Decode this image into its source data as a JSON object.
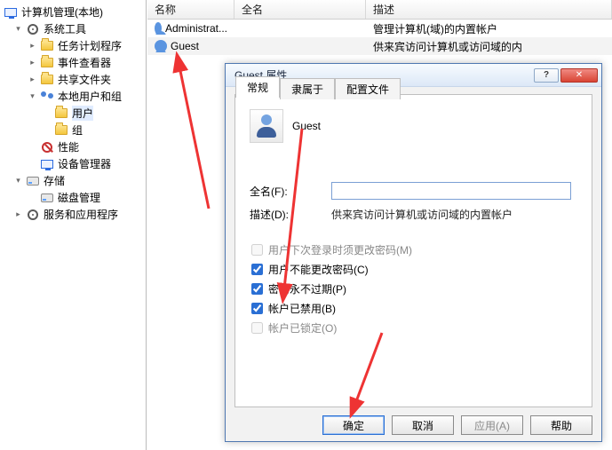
{
  "tree": {
    "root": "计算机管理(本地)",
    "items": [
      {
        "toggle": "▾",
        "icon": "gear",
        "label": "系统工具"
      },
      {
        "toggle": "▸",
        "icon": "folder",
        "label": "任务计划程序",
        "depth": 3
      },
      {
        "toggle": "▸",
        "icon": "folder",
        "label": "事件查看器",
        "depth": 3
      },
      {
        "toggle": "▸",
        "icon": "folder",
        "label": "共享文件夹",
        "depth": 3
      },
      {
        "toggle": "▾",
        "icon": "users",
        "label": "本地用户和组",
        "depth": 3
      },
      {
        "toggle": "",
        "icon": "folder",
        "label": "用户",
        "depth": 4,
        "selected": true
      },
      {
        "toggle": "",
        "icon": "folder",
        "label": "组",
        "depth": 4
      },
      {
        "toggle": "",
        "icon": "noentry",
        "label": "性能",
        "depth": 3
      },
      {
        "toggle": "",
        "icon": "monitor",
        "label": "设备管理器",
        "depth": 3
      },
      {
        "toggle": "▾",
        "icon": "disk",
        "label": "存储",
        "depth": 2
      },
      {
        "toggle": "",
        "icon": "disk",
        "label": "磁盘管理",
        "depth": 3
      },
      {
        "toggle": "▸",
        "icon": "gear",
        "label": "服务和应用程序",
        "depth": 2
      }
    ]
  },
  "list": {
    "headers": {
      "name": "名称",
      "full": "全名",
      "desc": "描述"
    },
    "rows": [
      {
        "name": "Administrat...",
        "full": "",
        "desc": "管理计算机(域)的内置帐户"
      },
      {
        "name": "Guest",
        "full": "",
        "desc": "供来宾访问计算机或访问域的内"
      }
    ]
  },
  "dialog": {
    "title": "Guest 属性",
    "tabs": [
      "常规",
      "隶属于",
      "配置文件"
    ],
    "active_tab": 0,
    "username": "Guest",
    "labels": {
      "fullname": "全名(F):",
      "desc": "描述(D):"
    },
    "fullname_value": "",
    "desc_value": "供来宾访问计算机或访问域的内置帐户",
    "checkboxes": [
      {
        "label": "用户下次登录时须更改密码(M)",
        "checked": false,
        "disabled": true
      },
      {
        "label": "用户不能更改密码(C)",
        "checked": true,
        "disabled": false
      },
      {
        "label": "密码永不过期(P)",
        "checked": true,
        "disabled": false
      },
      {
        "label": "帐户已禁用(B)",
        "checked": true,
        "disabled": false
      },
      {
        "label": "帐户已锁定(O)",
        "checked": false,
        "disabled": true
      }
    ],
    "buttons": {
      "ok": "确定",
      "cancel": "取消",
      "apply": "应用(A)",
      "help": "帮助"
    }
  }
}
